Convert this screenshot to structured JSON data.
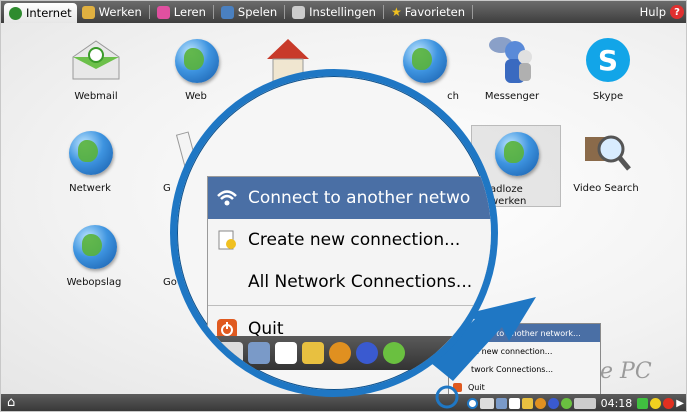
{
  "tabs": [
    {
      "label": "Internet",
      "icon": "internet-icon",
      "active": true,
      "color": "#2e8b2e"
    },
    {
      "label": "Werken",
      "icon": "work-icon",
      "active": false,
      "color": "#e0b040"
    },
    {
      "label": "Leren",
      "icon": "learn-icon",
      "active": false,
      "color": "#e050a0"
    },
    {
      "label": "Spelen",
      "icon": "play-icon",
      "active": false,
      "color": "#4a80c0"
    },
    {
      "label": "Instellingen",
      "icon": "settings-icon",
      "active": false,
      "color": "#cccccc"
    },
    {
      "label": "Favorieten",
      "icon": "favorites-icon",
      "active": false,
      "color": "#f0c020"
    }
  ],
  "help": {
    "label": "Hulp",
    "icon": "help-icon"
  },
  "apps": [
    {
      "label": "Webmail",
      "icon": "webmail-icon"
    },
    {
      "label": "Web",
      "icon": "web-icon"
    },
    {
      "label": "",
      "icon": "home-page-icon"
    },
    {
      "label": "ch",
      "icon": "google-search-icon"
    },
    {
      "label": "Messenger",
      "icon": "messenger-icon"
    },
    {
      "label": "Skype",
      "icon": "skype-icon"
    },
    {
      "label": "Netwerk",
      "icon": "network-icon"
    },
    {
      "label": "G",
      "icon": "document-icon"
    },
    {
      "label": "adloze\nwerken",
      "icon": "wireless-network-icon"
    },
    {
      "label": "Video Search",
      "icon": "video-search-icon"
    },
    {
      "label": "Webopslag",
      "icon": "web-storage-icon"
    },
    {
      "label": "Go",
      "icon": "generic-app-icon"
    }
  ],
  "magnified_menu": {
    "items": [
      {
        "label": "Connect to another network",
        "display": "Connect to another netwo",
        "highlighted": true,
        "icon": "wifi-icon"
      },
      {
        "label": "Create new connection...",
        "highlighted": false,
        "icon": "new-connection-icon"
      },
      {
        "label": "All Network Connections...",
        "highlighted": false,
        "icon": ""
      },
      {
        "label": "Quit",
        "highlighted": false,
        "icon": "quit-icon"
      }
    ]
  },
  "small_menu": {
    "items": [
      {
        "label": "nnect to another network..."
      },
      {
        "label": "te new connection..."
      },
      {
        "label": "twork Connections..."
      },
      {
        "label": "Quit"
      }
    ]
  },
  "brand": "ee PC",
  "clock": "04:18",
  "colors": {
    "accent": "#1f77c4",
    "highlight": "#4a6fa5",
    "panel": "#3e3e3e"
  }
}
